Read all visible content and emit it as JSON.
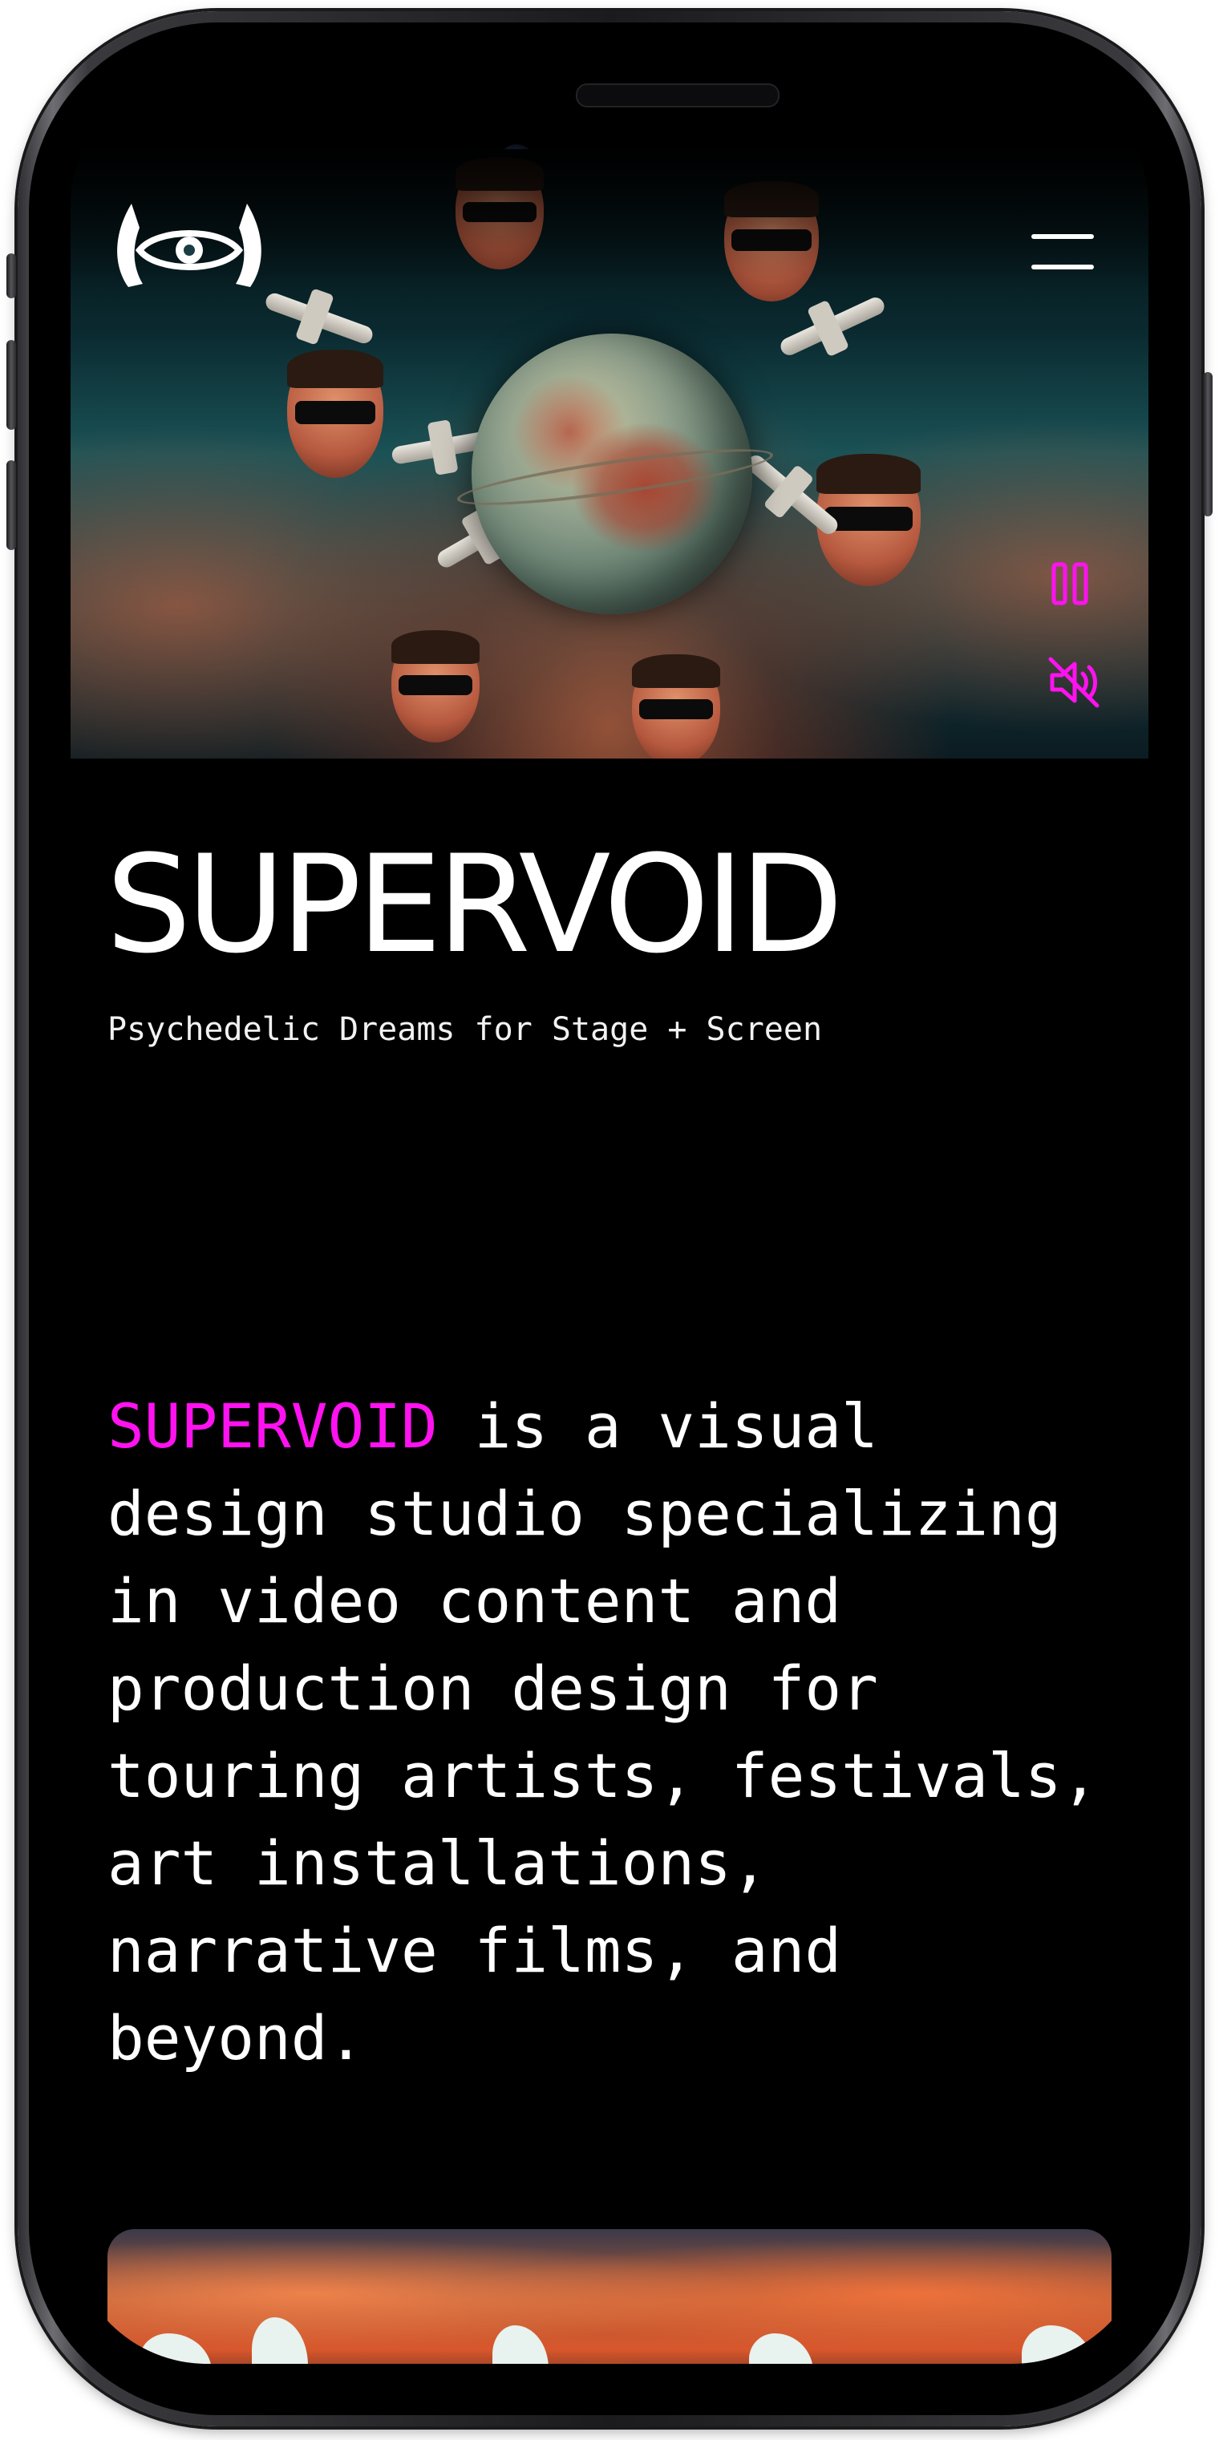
{
  "site": {
    "brand_name": "SUPERVOID",
    "tagline": "Psychedelic Dreams for Stage + Screen",
    "intro": {
      "highlight": "SUPERVOID",
      "text": " is a visual design studio specializing in video content and production design for touring artists, festivals, art installations, narrative films, and beyond."
    }
  },
  "hero": {
    "menu_icon": "hamburger-icon",
    "pause_icon": "pause-icon",
    "mute_icon": "speaker-muted-icon"
  },
  "colors": {
    "background": "#000000",
    "text": "#ffffff",
    "accent": "#ff12f0"
  }
}
